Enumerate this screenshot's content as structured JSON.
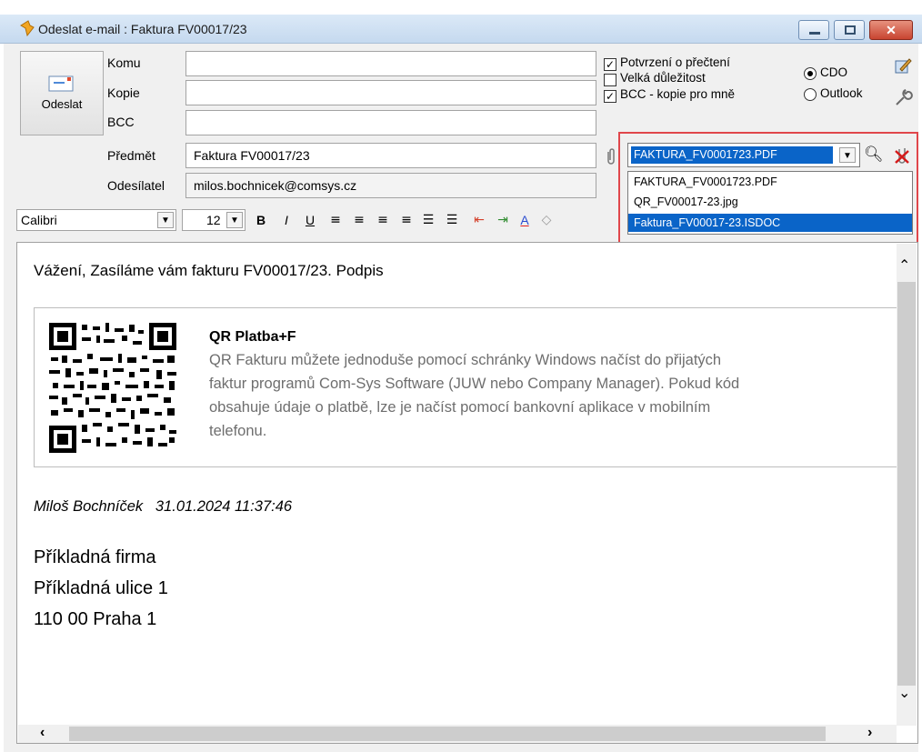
{
  "window": {
    "title": "Odeslat e-mail : Faktura FV00017/23"
  },
  "send_button": {
    "label": "Odeslat"
  },
  "fields": {
    "to_label": "Komu",
    "to_value": "",
    "cc_label": "Kopie",
    "cc_value": "",
    "bcc_label": "BCC",
    "bcc_value": "",
    "subject_label": "Předmět",
    "subject_value": "Faktura FV00017/23",
    "sender_label": "Odesílatel",
    "sender_value": "milos.bochnicek@comsys.cz"
  },
  "options": {
    "read_receipt": {
      "label": "Potvrzení o přečtení",
      "checked": true
    },
    "high_importance": {
      "label": "Velká důležitost",
      "checked": false
    },
    "bcc_self": {
      "label": "BCC - kopie pro mně",
      "checked": true
    },
    "method_cdo": {
      "label": "CDO",
      "selected": true
    },
    "method_outlook": {
      "label": "Outlook",
      "selected": false
    }
  },
  "attachments": {
    "selected": "FAKTURA_FV0001723.PDF",
    "items": [
      "FAKTURA_FV0001723.PDF",
      "QR_FV00017-23.jpg",
      "Faktura_FV00017-23.ISDOC"
    ],
    "highlighted_index": 2
  },
  "format_toolbar": {
    "font": "Calibri",
    "size": "12",
    "bold": "B",
    "italic": "I",
    "underline": "U"
  },
  "body": {
    "greeting": "Vážení, Zasíláme vám fakturu FV00017/23. Podpis",
    "qr_title": "QR Platba+F",
    "qr_text_1": "QR Fakturu můžete jednoduše pomocí schránky Windows načíst do přijatých",
    "qr_text_2": "faktur programů Com-Sys Software (JUW nebo Company Manager). Pokud kód",
    "qr_text_3": "obsahuje údaje o platbě, lze je načíst pomocí bankovní aplikace v mobilním",
    "qr_text_4": "telefonu.",
    "signature": "Miloš Bochníček   31.01.2024 11:37:46",
    "company": "Příkladná firma",
    "street": "Příkladná ulice 1",
    "city": "110 00 Praha 1"
  },
  "colors": {
    "highlight": "#0a64c8",
    "accent_border": "#e0464b",
    "qr_text": "#6e6e6e"
  }
}
